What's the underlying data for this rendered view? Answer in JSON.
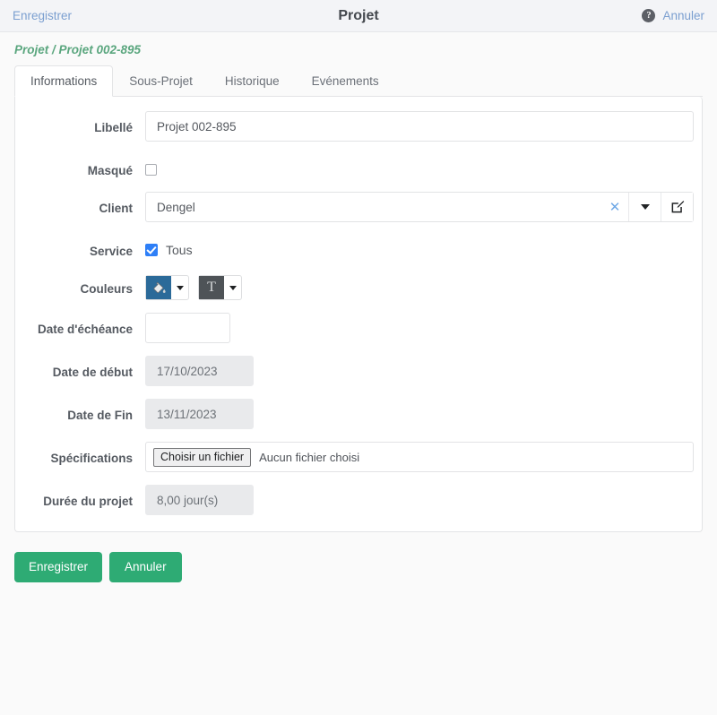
{
  "topbar": {
    "save_label": "Enregistrer",
    "title": "Projet",
    "help_icon": "help-circle-icon",
    "cancel_label": "Annuler"
  },
  "breadcrumb": "Projet / Projet 002-895",
  "tabs": [
    {
      "label": "Informations",
      "active": true
    },
    {
      "label": "Sous-Projet",
      "active": false
    },
    {
      "label": "Historique",
      "active": false
    },
    {
      "label": "Evénements",
      "active": false
    }
  ],
  "form": {
    "libelle": {
      "label": "Libellé",
      "value": "Projet 002-895"
    },
    "masque": {
      "label": "Masqué",
      "checked": false
    },
    "client": {
      "label": "Client",
      "value": "Dengel",
      "clear_icon": "clear-x-icon",
      "dropdown_icon": "chevron-down-icon",
      "edit_icon": "edit-pencil-square-icon"
    },
    "service": {
      "label": "Service",
      "checkbox_label": "Tous",
      "checked": true
    },
    "couleurs": {
      "label": "Couleurs",
      "fill_icon": "paint-bucket-icon",
      "fill_color": "#2b6a99",
      "text_icon": "text-color-T-icon",
      "text_color": "#4e5357",
      "caret_icon": "caret-down-icon"
    },
    "date_echeance": {
      "label": "Date d'échéance",
      "value": ""
    },
    "date_debut": {
      "label": "Date de début",
      "value": "17/10/2023"
    },
    "date_fin": {
      "label": "Date de Fin",
      "value": "13/11/2023"
    },
    "specifications": {
      "label": "Spécifications",
      "button_label": "Choisir un fichier",
      "status": "Aucun fichier choisi"
    },
    "duree": {
      "label": "Durée du projet",
      "value": "8,00 jour(s)"
    }
  },
  "footer": {
    "save_label": "Enregistrer",
    "cancel_label": "Annuler"
  },
  "colors": {
    "accent_green": "#2eab74",
    "link_blue": "#7b9fd0",
    "breadcrumb_green": "#5aa67e",
    "checkbox_blue": "#2e7ff7"
  }
}
